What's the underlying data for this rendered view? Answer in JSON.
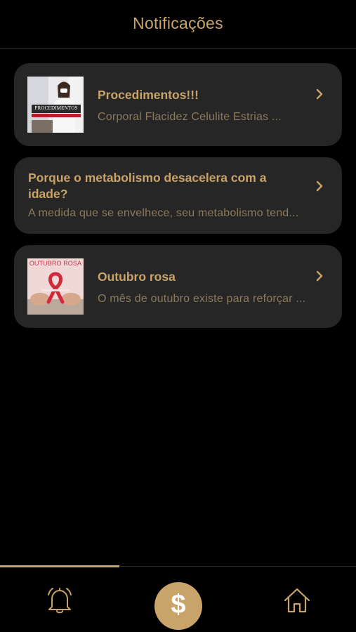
{
  "header": {
    "title": "Notificações"
  },
  "notifications": [
    {
      "title": "Procedimentos!!!",
      "preview": "Corporal Flacidez Celulite Estrias ...",
      "thumb_text": "PROCEDIMENTOS",
      "has_thumb": true
    },
    {
      "title_line1": "Porque o metabolismo desacelera com a",
      "title_line2": "idade?",
      "preview": "A medida que se envelhece, seu metabolismo tend...",
      "has_thumb": false
    },
    {
      "title": "Outubro rosa",
      "preview": "O mês de outubro existe para reforçar ...",
      "thumb_text": "OUTUBRO ROSA",
      "has_thumb": true
    }
  ],
  "tabbar": {
    "money_symbol": "$",
    "active_tab": "notifications",
    "icons": [
      "bell-icon",
      "dollar-icon",
      "home-icon"
    ]
  },
  "colors": {
    "accent": "#c9a46a",
    "card_bg": "#262626",
    "preview_text": "#8c7a5c",
    "background": "#000000"
  }
}
